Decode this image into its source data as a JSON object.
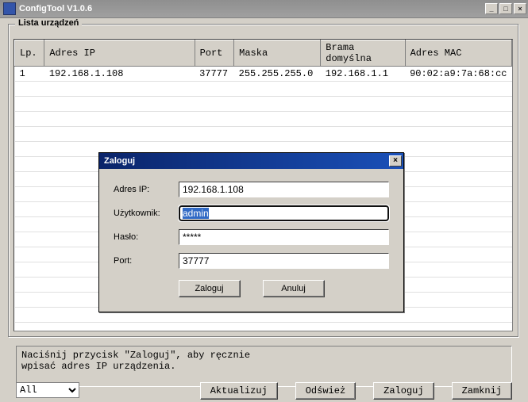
{
  "window": {
    "title": "ConfigTool V1.0.6"
  },
  "group": {
    "title": "Lista urządzeń"
  },
  "table": {
    "headers": {
      "lp": "Lp.",
      "ip": "Adres IP",
      "port": "Port",
      "mask": "Maska",
      "gateway": "Brama domyślna",
      "mac": "Adres MAC"
    },
    "rows": [
      {
        "lp": "1",
        "ip": "192.168.1.108",
        "port": "37777",
        "mask": "255.255.255.0",
        "gateway": "192.168.1.1",
        "mac": "90:02:a9:7a:68:cc"
      }
    ]
  },
  "hint": {
    "line1": "Naciśnij przycisk \"Zaloguj\", aby ręcznie",
    "line2": "wpisać adres IP urządzenia."
  },
  "filter": {
    "selected": "All"
  },
  "bottom_buttons": {
    "update": "Aktualizuj",
    "refresh": "Odśwież",
    "login": "Zaloguj",
    "close": "Zamknij"
  },
  "dialog": {
    "title": "Zaloguj",
    "labels": {
      "ip": "Adres IP:",
      "user": "Użytkownik:",
      "password": "Hasło:",
      "port": "Port:"
    },
    "values": {
      "ip": "192.168.1.108",
      "user": "admin",
      "password": "*****",
      "port": "37777"
    },
    "buttons": {
      "login": "Zaloguj",
      "cancel": "Anuluj"
    }
  }
}
